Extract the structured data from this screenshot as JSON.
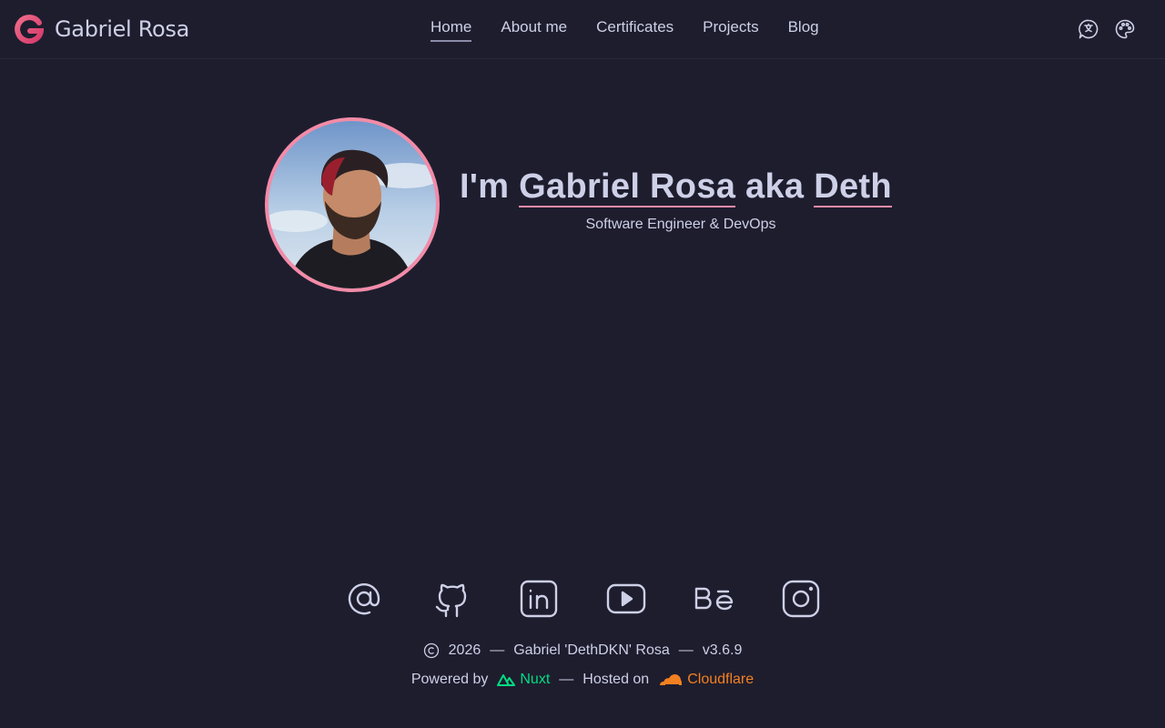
{
  "brand": {
    "name": "Gabriel Rosa",
    "accent": "#f38ba8",
    "icon": "g-logo-icon"
  },
  "nav": {
    "items": [
      {
        "label": "Home",
        "active": true
      },
      {
        "label": "About me",
        "active": false
      },
      {
        "label": "Certificates",
        "active": false
      },
      {
        "label": "Projects",
        "active": false
      },
      {
        "label": "Blog",
        "active": false
      }
    ]
  },
  "toolbar": {
    "language_icon": "translate-icon",
    "theme_icon": "palette-icon"
  },
  "hero": {
    "prefix": "I'm",
    "name": "Gabriel Rosa",
    "aka": "aka",
    "nickname": "Deth",
    "subtitle": "Software Engineer & DevOps"
  },
  "socials": [
    "email-icon",
    "github-icon",
    "linkedin-icon",
    "youtube-icon",
    "behance-icon",
    "instagram-icon"
  ],
  "footer": {
    "year": "2026",
    "sep": "—",
    "author": "Gabriel 'DethDKN' Rosa",
    "version": "v3.6.9",
    "powered_by": "Powered by",
    "nuxt": "Nuxt",
    "hosted_on": "Hosted on",
    "cloudflare": "Cloudflare"
  },
  "colors": {
    "background": "#1e1d2e",
    "text": "#cdd0e6",
    "nuxt": "#00dc82",
    "cloudflare": "#f38020"
  }
}
